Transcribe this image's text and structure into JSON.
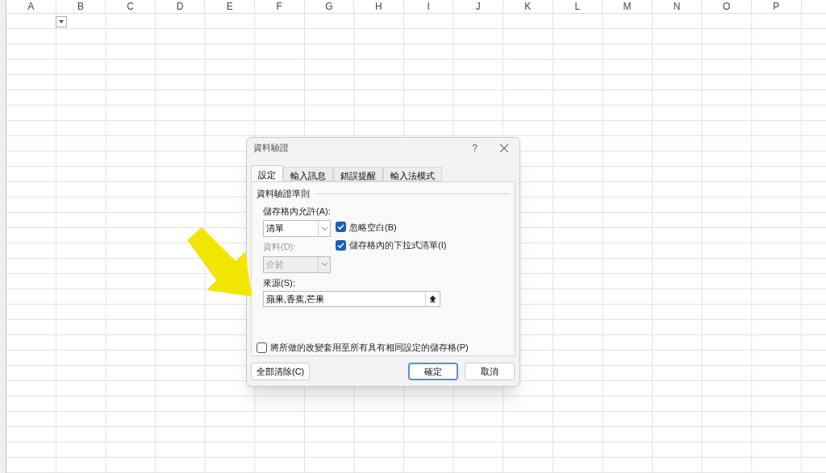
{
  "sheet": {
    "columns": [
      "A",
      "B",
      "C",
      "D",
      "E",
      "F",
      "G",
      "H",
      "I",
      "J",
      "K",
      "L",
      "M",
      "N",
      "O",
      "P"
    ]
  },
  "dialog": {
    "title": "資料驗證",
    "help": "?",
    "tabs": [
      {
        "label": "設定",
        "selected": true
      },
      {
        "label": "輸入訊息",
        "selected": false
      },
      {
        "label": "錯誤提醒",
        "selected": false
      },
      {
        "label": "輸入法模式",
        "selected": false
      }
    ],
    "section_title": "資料驗證準則",
    "allow": {
      "label": "儲存格內允許(A):",
      "value": "清單"
    },
    "options": [
      {
        "label": "忽略空白(B)",
        "checked": true
      },
      {
        "label": "儲存格內的下拉式清單(I)",
        "checked": true
      }
    ],
    "data": {
      "label": "資料(D):",
      "value": "介於",
      "disabled": true
    },
    "source": {
      "label": "來源(S):",
      "value": "蘋果,香蕉,芒果"
    },
    "apply_all": {
      "label": "將所做的改變套用至所有具有相同設定的儲存格(P)",
      "checked": false
    },
    "buttons": {
      "clear": "全部清除(C)",
      "ok": "確定",
      "cancel": "取消"
    }
  }
}
